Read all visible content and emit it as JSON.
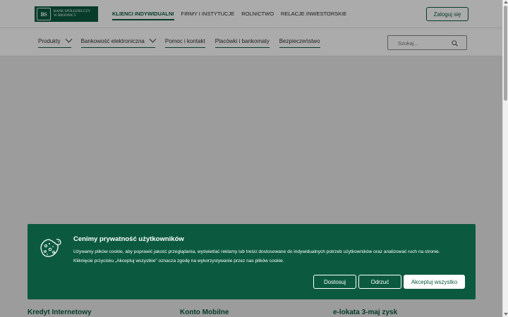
{
  "brand": {
    "logo_mark": "BS",
    "logo_line1": "Bank Spółdzielczy",
    "logo_line2": "w Brodnicy",
    "logo_year": "1862 r.",
    "color_primary": "#0b5a3f"
  },
  "segments": [
    {
      "label": "KLIENCI INDYWIDUALNI",
      "active": true
    },
    {
      "label": "FIRMY I INSTYTUCJE",
      "active": false
    },
    {
      "label": "ROLNICTWO",
      "active": false
    },
    {
      "label": "RELACJE INWESTORSKIE",
      "active": false
    }
  ],
  "login_label": "Zaloguj się",
  "nav": [
    {
      "label": "Produkty",
      "has_dropdown": true
    },
    {
      "label": "Bankowość elektroniczna",
      "has_dropdown": true
    },
    {
      "label": "Pomoc i kontakt",
      "has_dropdown": false
    },
    {
      "label": "Placówki i bankomaty",
      "has_dropdown": false
    },
    {
      "label": "Bezpieczeństwo",
      "has_dropdown": false
    }
  ],
  "search": {
    "placeholder": "Szukaj...",
    "icon": "search-icon"
  },
  "teasers": [
    {
      "title": "Kredyt Internetowy"
    },
    {
      "title": "Konto Mobilne"
    },
    {
      "title": "e-lokata 3-maj zysk"
    }
  ],
  "cookie_banner": {
    "icon": "cookie-icon",
    "title": "Cenimy prywatność użytkowników",
    "text_line1": "Używamy plików cookie, aby poprawić jakość przeglądania, wyświetlać reklamy lub treści dostosowane do indywidualnych potrzeb użytkowników oraz analizować ruch na stronie.",
    "text_line2": "Kliknięcie przycisku „Akceptuj wszystkie” oznacza zgodę na wykorzystywanie przez nas plików cookie.",
    "customize_label": "Dostosuj",
    "reject_label": "Odrzuć",
    "accept_label": "Akceptuj wszystko"
  }
}
